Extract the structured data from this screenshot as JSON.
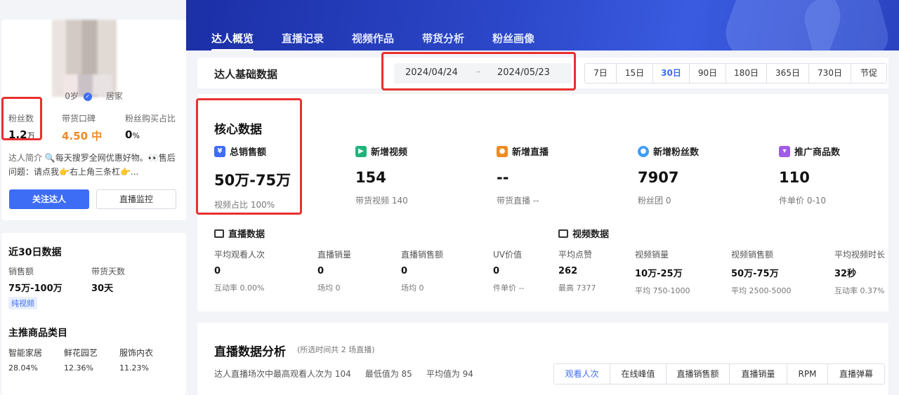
{
  "profile": {
    "age": "0岁",
    "verify_icon": "check-badge-icon",
    "category": "居家",
    "fans_label": "粉丝数",
    "fans_value": "1.2",
    "fans_unit": "万",
    "rating_label": "带货口碑",
    "rating_value": "4.50 中",
    "buy_ratio_label": "粉丝购买占比",
    "buy_ratio_value": "0",
    "buy_ratio_unit": "%",
    "intro_label": "达人简介",
    "intro_text": "🔍每天搜罗全网优惠好物。👀售后问题：请点我👉右上角三条杠👉...",
    "follow_button": "关注达人",
    "monitor_button": "直播监控"
  },
  "recent": {
    "title": "近30日数据",
    "sales_label": "销售额",
    "sales_value": "75万-100万",
    "days_label": "带货天数",
    "days_value": "30天",
    "tag": "纯视频",
    "category_title": "主推商品类目",
    "categories": [
      {
        "name": "智能家居",
        "pct": "28.04%"
      },
      {
        "name": "鲜花园艺",
        "pct": "12.36%"
      },
      {
        "name": "服饰内衣",
        "pct": "11.23%"
      }
    ]
  },
  "tabs": [
    "达人概览",
    "直播记录",
    "视频作品",
    "带货分析",
    "粉丝画像"
  ],
  "basic": {
    "title": "达人基础数据",
    "start_date": "2024/04/24",
    "separator": "–",
    "end_date": "2024/05/23",
    "ranges": [
      "7日",
      "15日",
      "30日",
      "90日",
      "180日",
      "365日",
      "730日",
      "节促"
    ],
    "active_range": "30日"
  },
  "core": {
    "title": "核心数据",
    "metrics": [
      {
        "label": "总销售额",
        "value": "50万-75万",
        "sub": "视频占比 100%",
        "icon": "yuan-icon",
        "color": "#3e6df5"
      },
      {
        "label": "新增视频",
        "value": "154",
        "sub": "带货视频 140",
        "icon": "video-play-icon",
        "color": "#22b37a"
      },
      {
        "label": "新增直播",
        "value": "--",
        "sub": "带货直播 --",
        "icon": "live-stream-icon",
        "color": "#f08a24"
      },
      {
        "label": "新增粉丝数",
        "value": "7907",
        "sub": "粉丝团 0",
        "icon": "user-icon",
        "color": "#3e9cf5"
      },
      {
        "label": "推广商品数",
        "value": "110",
        "sub": "件单价 0-10",
        "icon": "shopping-bag-icon",
        "color": "#a05ce8"
      }
    ],
    "live_title": "直播数据",
    "live": [
      {
        "label": "平均观看人次",
        "value": "0",
        "sub": "互动率 0.00%"
      },
      {
        "label": "直播销量",
        "value": "0",
        "sub": "场均 0"
      },
      {
        "label": "直播销售额",
        "value": "0",
        "sub": "场均 0"
      },
      {
        "label": "UV价值",
        "value": "0",
        "sub": "件单价 --"
      }
    ],
    "video_title": "视频数据",
    "video": [
      {
        "label": "平均点赞",
        "value": "262",
        "sub": "最高 7377"
      },
      {
        "label": "视频销量",
        "value": "10万-25万",
        "sub": "平均 750-1000"
      },
      {
        "label": "视频销售额",
        "value": "50万-75万",
        "sub": "平均 2500-5000"
      },
      {
        "label": "平均视频时长",
        "value": "32秒",
        "sub": "互动率 0.37%"
      }
    ]
  },
  "live_analysis": {
    "title": "直播数据分析",
    "note": "(所选时间共 2 场直播)",
    "summary": [
      "达人直播场次中最高观看人次为 104",
      "最低值为 85",
      "平均值为 94"
    ],
    "tabs": [
      "观看人次",
      "在线峰值",
      "直播销售额",
      "直播销量",
      "RPM",
      "直播弹幕"
    ],
    "active_tab": "观看人次"
  }
}
